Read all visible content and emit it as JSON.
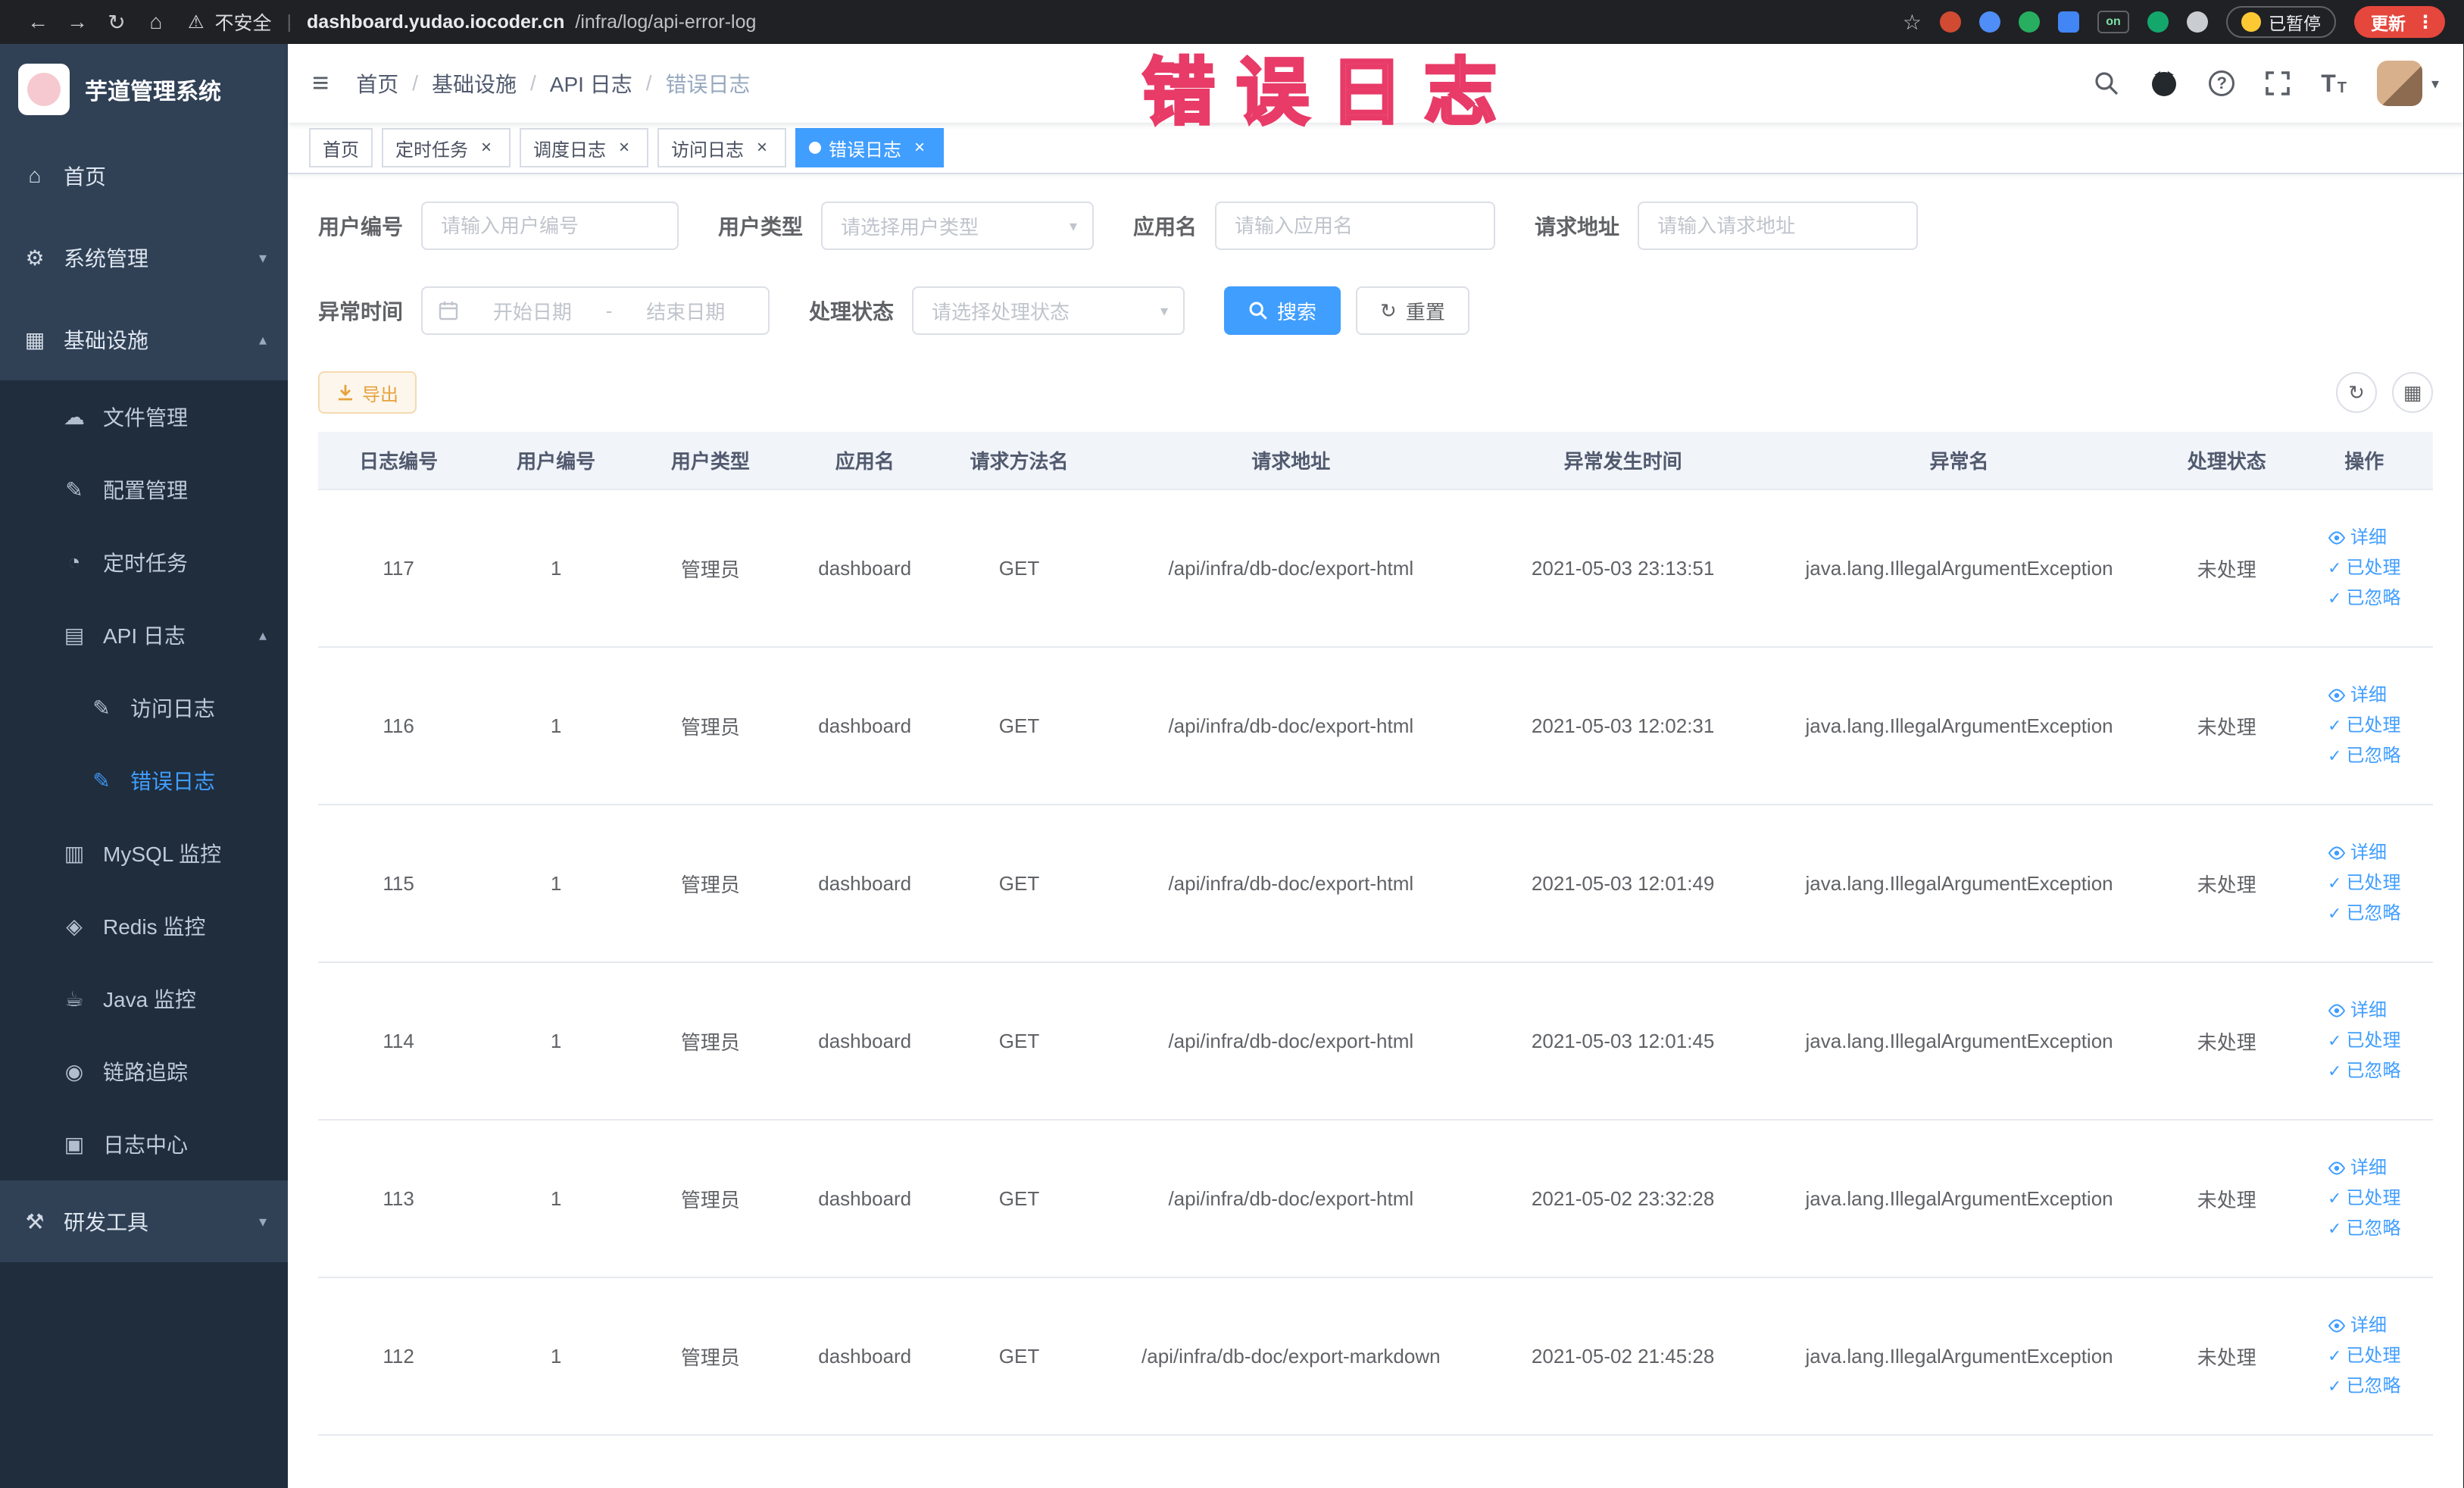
{
  "browser": {
    "security_label": "不安全",
    "url_host": "dashboard.yudao.iocoder.cn",
    "url_path": "/infra/log/api-error-log",
    "paused_badge": "已暂停",
    "update_button": "更新",
    "extension_on_badge": "on"
  },
  "overlay": {
    "title": "错误日志"
  },
  "navbar": {
    "breadcrumb": [
      "首页",
      "基础设施",
      "API 日志",
      "错误日志"
    ]
  },
  "sidebar": {
    "logo_title": "芋道管理系统",
    "menu": [
      {
        "id": "home",
        "label": "首页",
        "icon": "home",
        "level": 1
      },
      {
        "id": "system",
        "label": "系统管理",
        "icon": "gear",
        "level": 1,
        "chevron": "down"
      },
      {
        "id": "infra",
        "label": "基础设施",
        "icon": "infra",
        "level": 1,
        "chevron": "up"
      },
      {
        "id": "file",
        "label": "文件管理",
        "icon": "cloud",
        "level": 2
      },
      {
        "id": "config",
        "label": "配置管理",
        "icon": "edit",
        "level": 2
      },
      {
        "id": "job",
        "label": "定时任务",
        "icon": "clock",
        "level": 2
      },
      {
        "id": "api-log",
        "label": "API 日志",
        "icon": "doc",
        "level": 2,
        "chevron": "up"
      },
      {
        "id": "access-log",
        "label": "访问日志",
        "icon": "edit",
        "level": 3
      },
      {
        "id": "error-log",
        "label": "错误日志",
        "icon": "edit",
        "level": 3,
        "active": true
      },
      {
        "id": "mysql",
        "label": "MySQL 监控",
        "icon": "db",
        "level": 2
      },
      {
        "id": "redis",
        "label": "Redis 监控",
        "icon": "redis",
        "level": 2
      },
      {
        "id": "java",
        "label": "Java 监控",
        "icon": "java",
        "level": 2
      },
      {
        "id": "trace",
        "label": "链路追踪",
        "icon": "eye",
        "level": 2
      },
      {
        "id": "log-center",
        "label": "日志中心",
        "icon": "log",
        "level": 2
      },
      {
        "id": "dev-tools",
        "label": "研发工具",
        "icon": "tools",
        "level": 1,
        "chevron": "down"
      }
    ]
  },
  "tabs": {
    "items": [
      {
        "label": "首页",
        "closable": false
      },
      {
        "label": "定时任务",
        "closable": true
      },
      {
        "label": "调度日志",
        "closable": true
      },
      {
        "label": "访问日志",
        "closable": true
      },
      {
        "label": "错误日志",
        "closable": true,
        "active": true
      }
    ]
  },
  "filters": {
    "user_id": {
      "label": "用户编号",
      "placeholder": "请输入用户编号"
    },
    "user_type": {
      "label": "用户类型",
      "placeholder": "请选择用户类型"
    },
    "app_name": {
      "label": "应用名",
      "placeholder": "请输入应用名"
    },
    "request_url": {
      "label": "请求地址",
      "placeholder": "请输入请求地址"
    },
    "error_time": {
      "label": "异常时间",
      "start_placeholder": "开始日期",
      "separator": "-",
      "end_placeholder": "结束日期"
    },
    "process_status": {
      "label": "处理状态",
      "placeholder": "请选择处理状态"
    },
    "search_button": "搜索",
    "reset_button": "重置"
  },
  "toolbar": {
    "export_button": "导出"
  },
  "table": {
    "columns": [
      "日志编号",
      "用户编号",
      "用户类型",
      "应用名",
      "请求方法名",
      "请求地址",
      "异常发生时间",
      "异常名",
      "处理状态",
      "操作"
    ],
    "action_labels": [
      "详细",
      "已处理",
      "已忽略"
    ],
    "rows": [
      {
        "cells": [
          "117",
          "1",
          "管理员",
          "dashboard",
          "GET",
          "/api/infra/db-doc/export-html",
          "2021-05-03 23:13:51",
          "java.lang.IllegalArgumentException",
          "未处理"
        ]
      },
      {
        "cells": [
          "116",
          "1",
          "管理员",
          "dashboard",
          "GET",
          "/api/infra/db-doc/export-html",
          "2021-05-03 12:02:31",
          "java.lang.IllegalArgumentException",
          "未处理"
        ]
      },
      {
        "cells": [
          "115",
          "1",
          "管理员",
          "dashboard",
          "GET",
          "/api/infra/db-doc/export-html",
          "2021-05-03 12:01:49",
          "java.lang.IllegalArgumentException",
          "未处理"
        ]
      },
      {
        "cells": [
          "114",
          "1",
          "管理员",
          "dashboard",
          "GET",
          "/api/infra/db-doc/export-html",
          "2021-05-03 12:01:45",
          "java.lang.IllegalArgumentException",
          "未处理"
        ]
      },
      {
        "cells": [
          "113",
          "1",
          "管理员",
          "dashboard",
          "GET",
          "/api/infra/db-doc/export-html",
          "2021-05-02 23:32:28",
          "java.lang.IllegalArgumentException",
          "未处理"
        ]
      },
      {
        "cells": [
          "112",
          "1",
          "管理员",
          "dashboard",
          "GET",
          "/api/infra/db-doc/export-markdown",
          "2021-05-02 21:45:28",
          "java.lang.IllegalArgumentException",
          "未处理"
        ]
      }
    ]
  },
  "icons": {
    "back": "←",
    "forward": "→",
    "reload": "↻",
    "home": "⌂",
    "warning": "⚠",
    "pipe": "|",
    "star": "☆",
    "kebab": "⋮",
    "hamburger": "≡",
    "question": "?",
    "font_size": "T",
    "caret": "▾",
    "close": "×",
    "check": "✓",
    "detail_eye": "◉",
    "refresh": "↻",
    "grid": "▦",
    "separator_slash": "/",
    "chevron_down": "▾",
    "chevron_up": "▴",
    "gear": "⚙",
    "infra": "▦",
    "cloud": "☁",
    "edit": "✎",
    "clock": "◔",
    "doc": "▤",
    "db": "▥",
    "redis": "◈",
    "java": "☕",
    "eye": "◉",
    "log": "▣",
    "tools": "⚒"
  },
  "colors": {
    "accent": "#409eff",
    "active_tab_bg": "#409eff",
    "warning_text": "#e6a23c",
    "overlay_pink": "#f4688c",
    "sidebar_bg": "#304156",
    "submenu_bg": "#1f2d3d",
    "update_red": "#e5473d"
  }
}
